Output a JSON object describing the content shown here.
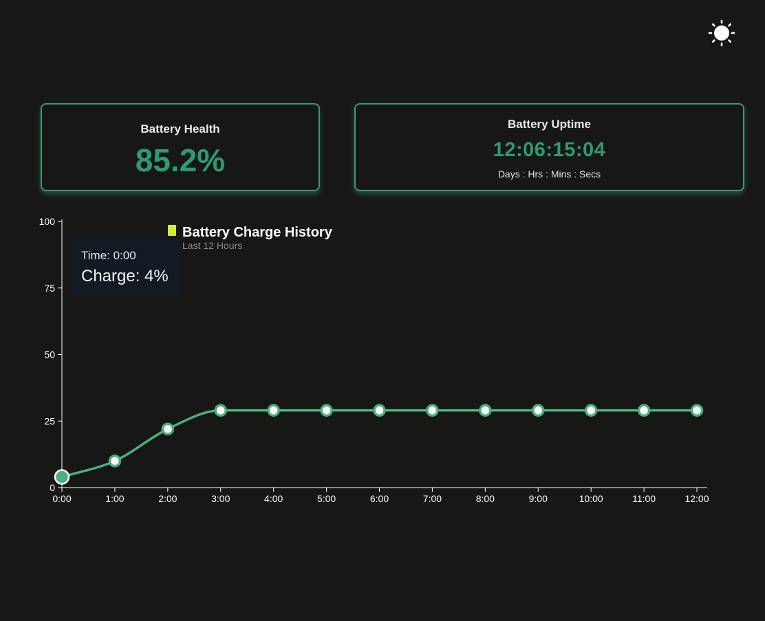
{
  "theme_toggle": {
    "icon": "sun-icon"
  },
  "health_card": {
    "title": "Battery Health",
    "value": "85.2%"
  },
  "uptime_card": {
    "title": "Battery Uptime",
    "value": "12:06:15:04",
    "units": "Days : Hrs : Mins : Secs"
  },
  "colors": {
    "accent": "#2e9a74",
    "line": "#4caf7d",
    "legend_swatch": "#d4ea3a",
    "tooltip_bg": "#121a24"
  },
  "tooltip": {
    "time_text": "Time: 0:00",
    "charge_text": "Charge: 4%"
  },
  "chart_data": {
    "type": "line",
    "title": "Battery Charge History",
    "subtitle": "Last 12 Hours",
    "categories": [
      "0:00",
      "1:00",
      "2:00",
      "3:00",
      "4:00",
      "5:00",
      "6:00",
      "7:00",
      "8:00",
      "9:00",
      "10:00",
      "11:00",
      "12:00"
    ],
    "series": [
      {
        "name": "Battery Charge History",
        "values": [
          4,
          10,
          22,
          29,
          29,
          29,
          29,
          29,
          29,
          29,
          29,
          29,
          29
        ]
      }
    ],
    "ylim": [
      0,
      100
    ],
    "yticks": [
      0,
      25,
      50,
      75,
      100
    ],
    "highlighted_index": 0,
    "grid": false,
    "legend_position": "top"
  }
}
